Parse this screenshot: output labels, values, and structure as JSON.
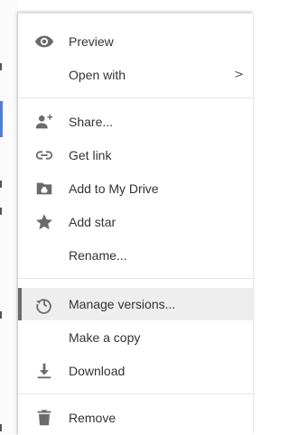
{
  "menu": {
    "items": [
      {
        "label": "Preview",
        "icon": "eye-icon"
      },
      {
        "label": "Open with",
        "icon": "",
        "submenu": true
      },
      {
        "label": "Share...",
        "icon": "add-person-icon"
      },
      {
        "label": "Get link",
        "icon": "link-icon"
      },
      {
        "label": "Add to My Drive",
        "icon": "drive-folder-icon"
      },
      {
        "label": "Add star",
        "icon": "star-icon"
      },
      {
        "label": "Rename...",
        "icon": ""
      },
      {
        "label": "Manage versions...",
        "icon": "history-icon",
        "selected": true
      },
      {
        "label": "Make a copy",
        "icon": ""
      },
      {
        "label": "Download",
        "icon": "download-icon"
      },
      {
        "label": "Remove",
        "icon": "trash-icon"
      }
    ],
    "submenu_indicator": ">"
  },
  "colors": {
    "icon": "#6b6b6b",
    "text": "#333333",
    "selected_bg": "#eeeeee",
    "selected_bar": "#6b6b6b",
    "page_accent": "#4a7de0"
  }
}
